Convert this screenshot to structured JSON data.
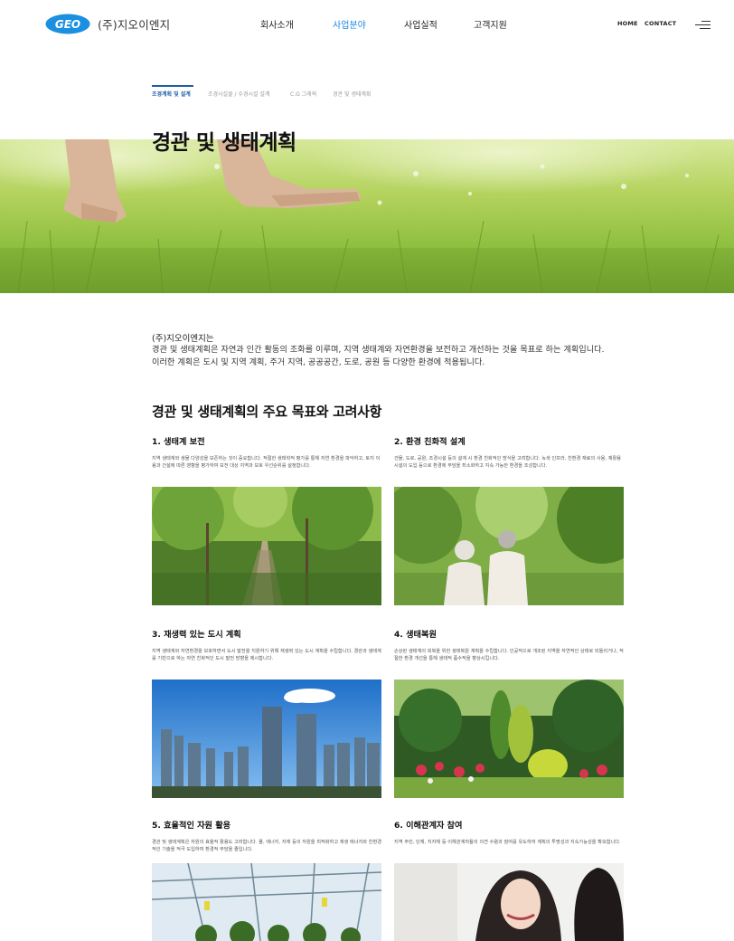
{
  "header": {
    "logo_badge": "GEO",
    "logo_text": "(주)지오이엔지",
    "nav": [
      "회사소개",
      "사업분야",
      "사업실적",
      "고객지원"
    ],
    "active_nav": 1,
    "util_home": "HOME",
    "util_contact": "CONTACT"
  },
  "subtabs": [
    "조경계획 및 설계",
    "조경시설물 / 수경시설 설계",
    "C.G 그래픽",
    "경관 및 생태계획"
  ],
  "hero": {
    "title": "경관 및 생태계획"
  },
  "intro": {
    "company": "(주)지오이엔지는",
    "text": "경관 및 생태계획은 자연과 인간 활동의 조화를 이루며, 지역 생태계와 자연환경을 보전하고 개선하는 것을 목표로 하는 계획입니다. 이러한 계획은 도시 및 지역 계획, 주거 지역, 공공공간, 도로, 공원 등 다양한 환경에 적용됩니다."
  },
  "section": {
    "title": "경관 및 생태계획의 주요 목표와 고려사항"
  },
  "cards": [
    {
      "title": "1. 생태계 보전",
      "desc": "지역 생태계와 생물 다양성을 보존하는 것이 중요합니다. 적절한 생태학적 평가를 통해 자연 환경을 파악하고, 토지 이용과 건설에 따른 영향을 평가하여 보전 대상 지역과 보호 우선순위를 설정합니다.",
      "photo": "forest-path"
    },
    {
      "title": "2. 환경 친화적 설계",
      "desc": "건물, 도로, 공원, 조경시설 등의 설계 시 환경 친화적인 방식을 고려합니다. 녹색 인프라, 친환경 재료의 사용, 재활용 시설의 도입 등으로 환경에 부담을 최소화하고 지속 가능한 환경을 조성합니다.",
      "photo": "elderly-couple-walking"
    },
    {
      "title": "3. 재생력 있는 도시 계획",
      "desc": "지역 생태계와 자연환경을 보호하면서 도시 발전을 지원하기 위해 재생력 있는 도시 계획을 수립합니다. 경관과 생태계를 기반으로 하는 자연 친화적인 도시 발전 방향을 제시합니다.",
      "photo": "city-skyline"
    },
    {
      "title": "4. 생태복원",
      "desc": "손상된 생태계의 회복을 위한 생태복원 계획을 수립합니다. 인공적으로 개조된 지역을 자연적인 상태로 되돌리거나, 적절한 환경 개선을 통해 생태적 품수적을 향상시킵니다.",
      "photo": "garden"
    },
    {
      "title": "5. 효율적인 자원 활용",
      "desc": "경관 및 생태계획은 자원의 효율적 활용도 고려합니다. 물, 에너지, 자재 등의 자원을 최적화하고 재생 에너지와 친환경적인 기술을 적극 도입하여 환경적 부담을 줄입니다.",
      "photo": "greenhouse"
    },
    {
      "title": "6. 이해관계자 참여",
      "desc": "지역 주민, 단체, 지자체 등 이해관계자들의 의견 수렴과 참여를 유도하여 계획의 투명성과 지속가능성을 확보합니다.",
      "photo": "smiling-woman"
    }
  ],
  "colors": {
    "accent": "#1e88e5",
    "subtab_active": "#1e5fa8",
    "logo_blue": "#1b8fe0"
  }
}
